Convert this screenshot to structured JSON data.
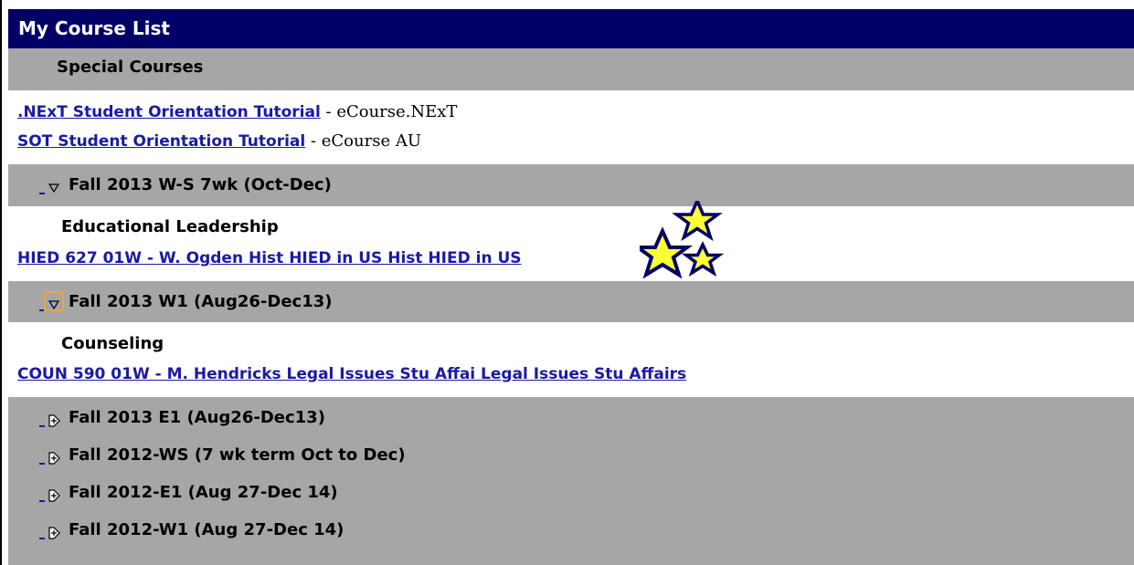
{
  "header": {
    "title": "My Course List"
  },
  "special": {
    "title": "Special Courses",
    "courses": [
      {
        "link": ".NExT Student Orientation Tutorial",
        "suffix": " - eCourse.NExT"
      },
      {
        "link": "SOT Student Orientation Tutorial",
        "suffix": " - eCourse AU"
      }
    ]
  },
  "terms": [
    {
      "label": "Fall 2013 W-S 7wk (Oct-Dec)",
      "state": "expanded",
      "toggle_icon": "collapse-triangle-icon",
      "department": "Educational Leadership",
      "course": "HIED 627 01W - W. Ogden Hist HIED in US Hist HIED in US"
    },
    {
      "label": "Fall 2013 W1 (Aug26-Dec13)",
      "state": "expanded",
      "toggle_icon": "collapse-triangle-icon",
      "department": "Counseling",
      "course": "COUN 590 01W - M. Hendricks Legal Issues Stu Affai Legal Issues Stu Affairs"
    },
    {
      "label": "Fall 2013 E1 (Aug26-Dec13)",
      "state": "collapsed",
      "toggle_icon": "expand-arrow-icon"
    },
    {
      "label": "Fall 2012-WS (7 wk term Oct to Dec)",
      "state": "collapsed",
      "toggle_icon": "expand-arrow-icon"
    },
    {
      "label": "Fall 2012-E1 (Aug 27-Dec 14)",
      "state": "collapsed",
      "toggle_icon": "expand-arrow-icon"
    },
    {
      "label": "Fall 2012-W1 (Aug 27-Dec 14)",
      "state": "collapsed",
      "toggle_icon": "expand-arrow-icon"
    }
  ],
  "decorations": {
    "stars_icon": "stars-icon",
    "star_fill": "#ffff33",
    "star_stroke": "#000066"
  },
  "colors": {
    "header": "#000066",
    "band": "#a6a6a6",
    "link": "#1a1aa6",
    "focus": "#e7a44b"
  }
}
